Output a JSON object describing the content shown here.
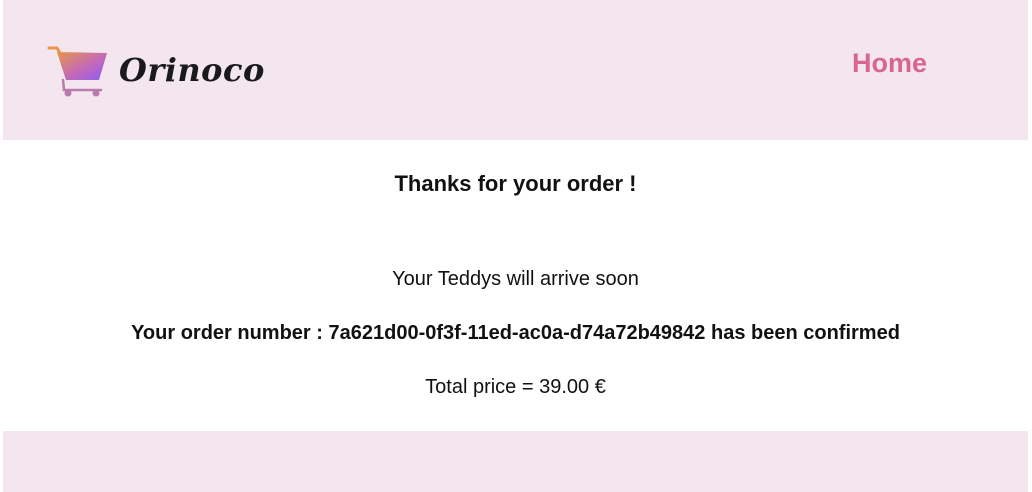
{
  "header": {
    "brand_name": "Orinoco",
    "logo_icon": "shopping-cart-icon",
    "nav": {
      "home_label": "Home"
    },
    "colors": {
      "background": "#f3e6ef",
      "nav_link": "#d9668f"
    }
  },
  "confirmation": {
    "title": "Thanks for your order !",
    "arrival_message": "Your Teddys will arrive soon",
    "order_prefix": "Your order number : ",
    "order_number": "7a621d00-0f3f-11ed-ac0a-d74a72b49842",
    "order_suffix": " has been confirmed",
    "total_prefix": "Total price = ",
    "total_price": "39.00 €"
  },
  "footer": {
    "background": "#f3e6ef"
  }
}
